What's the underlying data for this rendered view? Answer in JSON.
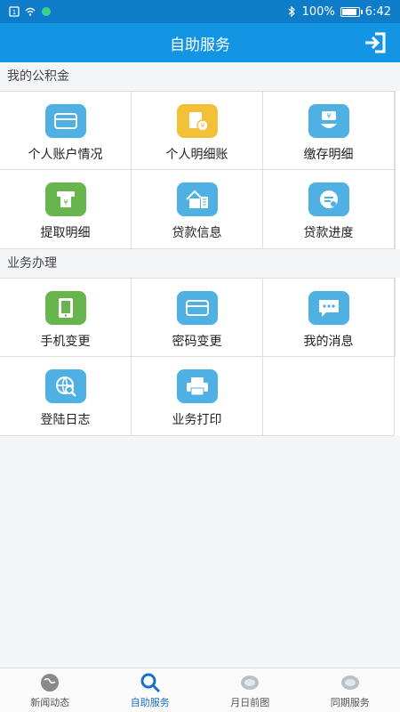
{
  "status": {
    "battery": "100%",
    "time": "6:42"
  },
  "header": {
    "title": "自助服务"
  },
  "sections": [
    {
      "title": "我的公积金",
      "items": [
        {
          "label": "个人账户情况",
          "icon": "wallet-icon",
          "color": "#4fb0e3"
        },
        {
          "label": "个人明细账",
          "icon": "ledger-icon",
          "color": "#f2c138"
        },
        {
          "label": "缴存明细",
          "icon": "deposit-icon",
          "color": "#4fb0e3"
        },
        {
          "label": "提取明细",
          "icon": "withdraw-icon",
          "color": "#68b54e"
        },
        {
          "label": "贷款信息",
          "icon": "house-icon",
          "color": "#4fb0e3"
        },
        {
          "label": "贷款进度",
          "icon": "progress-icon",
          "color": "#4fb0e3"
        }
      ]
    },
    {
      "title": "业务办理",
      "items": [
        {
          "label": "手机变更",
          "icon": "phone-icon",
          "color": "#68b54e"
        },
        {
          "label": "密码变更",
          "icon": "card-icon",
          "color": "#4fb0e3"
        },
        {
          "label": "我的消息",
          "icon": "message-icon",
          "color": "#4fb0e3"
        },
        {
          "label": "登陆日志",
          "icon": "globe-search-icon",
          "color": "#4fb0e3"
        },
        {
          "label": "业务打印",
          "icon": "printer-icon",
          "color": "#4fb0e3"
        }
      ]
    }
  ],
  "nav": [
    {
      "label": "新闻动态",
      "icon": "globe-icon",
      "active": false
    },
    {
      "label": "自助服务",
      "icon": "search-icon",
      "active": true
    },
    {
      "label": "月日前图",
      "icon": "blank-icon",
      "active": false
    },
    {
      "label": "同期服务",
      "icon": "blank-icon",
      "active": false
    }
  ],
  "colors": {
    "accent": "#1495e3",
    "status": "#0f7cc9",
    "nav_active": "#1a6fc7"
  }
}
